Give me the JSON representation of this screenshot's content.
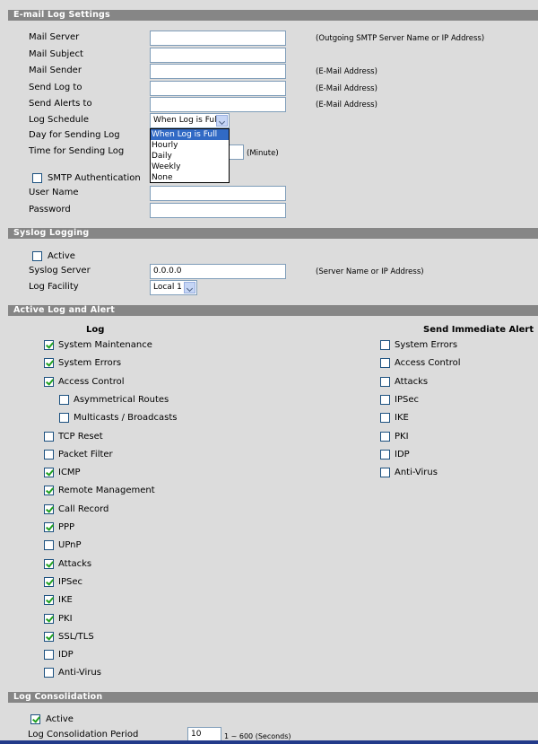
{
  "email_section": {
    "title": "E-mail Log Settings",
    "mail_server": {
      "label": "Mail Server",
      "value": "",
      "note": "(Outgoing SMTP Server Name or IP Address)"
    },
    "mail_subject": {
      "label": "Mail Subject",
      "value": ""
    },
    "mail_sender": {
      "label": "Mail Sender",
      "value": "",
      "note": "(E-Mail Address)"
    },
    "send_log_to": {
      "label": "Send Log to",
      "value": "",
      "note": "(E-Mail Address)"
    },
    "send_alerts_to": {
      "label": "Send Alerts to",
      "value": "",
      "note": "(E-Mail Address)"
    },
    "log_schedule": {
      "label": "Log Schedule",
      "value": "When Log is Full",
      "options": [
        "When Log is Full",
        "Hourly",
        "Daily",
        "Weekly",
        "None"
      ]
    },
    "day_for_sending": {
      "label": "Day for Sending Log"
    },
    "time_for_sending": {
      "label": "Time for Sending Log",
      "note": "(Minute)"
    },
    "smtp_auth": {
      "label": "SMTP Authentication",
      "checked": false
    },
    "user_name": {
      "label": "User Name",
      "value": ""
    },
    "password": {
      "label": "Password",
      "value": ""
    }
  },
  "syslog_section": {
    "title": "Syslog Logging",
    "active": {
      "label": "Active",
      "checked": false
    },
    "server": {
      "label": "Syslog Server",
      "value": "0.0.0.0",
      "note": "(Server Name or IP Address)"
    },
    "facility": {
      "label": "Log Facility",
      "value": "Local 1"
    }
  },
  "active_log_section": {
    "title": "Active Log and Alert",
    "log_header": "Log",
    "alert_header": "Send Immediate Alert",
    "log_items": [
      {
        "label": "System Maintenance",
        "checked": true,
        "indent": false
      },
      {
        "label": "System Errors",
        "checked": true,
        "indent": false
      },
      {
        "label": "Access Control",
        "checked": true,
        "indent": false
      },
      {
        "label": "Asymmetrical Routes",
        "checked": false,
        "indent": true
      },
      {
        "label": "Multicasts / Broadcasts",
        "checked": false,
        "indent": true
      },
      {
        "label": "TCP Reset",
        "checked": false,
        "indent": false
      },
      {
        "label": "Packet Filter",
        "checked": false,
        "indent": false
      },
      {
        "label": "ICMP",
        "checked": true,
        "indent": false
      },
      {
        "label": "Remote Management",
        "checked": true,
        "indent": false
      },
      {
        "label": "Call Record",
        "checked": true,
        "indent": false
      },
      {
        "label": "PPP",
        "checked": true,
        "indent": false
      },
      {
        "label": "UPnP",
        "checked": false,
        "indent": false
      },
      {
        "label": "Attacks",
        "checked": true,
        "indent": false
      },
      {
        "label": "IPSec",
        "checked": true,
        "indent": false
      },
      {
        "label": "IKE",
        "checked": true,
        "indent": false
      },
      {
        "label": "PKI",
        "checked": true,
        "indent": false
      },
      {
        "label": "SSL/TLS",
        "checked": true,
        "indent": false
      },
      {
        "label": "IDP",
        "checked": false,
        "indent": false
      },
      {
        "label": "Anti-Virus",
        "checked": false,
        "indent": false
      }
    ],
    "alert_items": [
      {
        "label": "System Errors",
        "checked": false
      },
      {
        "label": "Access Control",
        "checked": false
      },
      {
        "label": "Attacks",
        "checked": false
      },
      {
        "label": "IPSec",
        "checked": false
      },
      {
        "label": "IKE",
        "checked": false
      },
      {
        "label": "PKI",
        "checked": false
      },
      {
        "label": "IDP",
        "checked": false
      },
      {
        "label": "Anti-Virus",
        "checked": false
      }
    ]
  },
  "consolidation_section": {
    "title": "Log Consolidation",
    "active": {
      "label": "Active",
      "checked": true
    },
    "period": {
      "label": "Log Consolidation Period",
      "value": "10",
      "note": "1 ~ 600 (Seconds)"
    }
  }
}
